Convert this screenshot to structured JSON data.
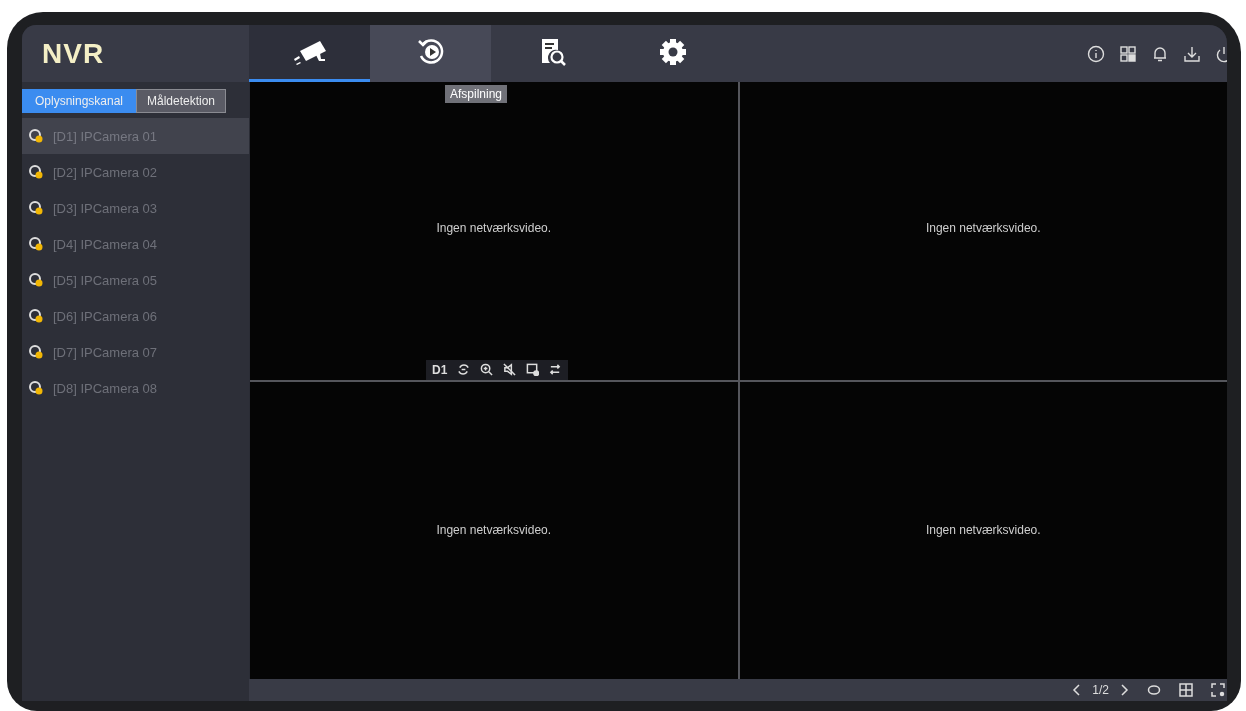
{
  "logo": "NVR",
  "nav_tabs": [
    {
      "kind": "live",
      "selected": true,
      "hovered": false
    },
    {
      "kind": "playback",
      "selected": false,
      "hovered": true,
      "tooltip": "Afspilning"
    },
    {
      "kind": "search",
      "selected": false,
      "hovered": false
    },
    {
      "kind": "settings",
      "selected": false,
      "hovered": false
    }
  ],
  "header_icons": [
    {
      "kind": "info"
    },
    {
      "kind": "qr"
    },
    {
      "kind": "bell"
    },
    {
      "kind": "download"
    },
    {
      "kind": "power"
    }
  ],
  "sidebar": {
    "tabs": [
      {
        "label": "Oplysningskanal",
        "selected": true
      },
      {
        "label": "Måldetektion",
        "selected": false
      }
    ],
    "channels": [
      {
        "label": "[D1] IPCamera 01",
        "selected": true
      },
      {
        "label": "[D2] IPCamera 02",
        "selected": false
      },
      {
        "label": "[D3] IPCamera 03",
        "selected": false
      },
      {
        "label": "[D4] IPCamera 04",
        "selected": false
      },
      {
        "label": "[D5] IPCamera 05",
        "selected": false
      },
      {
        "label": "[D6] IPCamera 06",
        "selected": false
      },
      {
        "label": "[D7] IPCamera 07",
        "selected": false
      },
      {
        "label": "[D8] IPCamera 08",
        "selected": false
      }
    ]
  },
  "tiles": [
    {
      "message": "Ingen netværksvideo.",
      "toolbar": {
        "label": "D1",
        "icons": [
          {
            "kind": "rotate"
          },
          {
            "kind": "zoom"
          },
          {
            "kind": "mute"
          },
          {
            "kind": "snapshot"
          },
          {
            "kind": "switch"
          }
        ]
      }
    },
    {
      "message": "Ingen netværksvideo."
    },
    {
      "message": "Ingen netværksvideo."
    },
    {
      "message": "Ingen netværksvideo."
    }
  ],
  "footer": {
    "page": "1/2",
    "icons": [
      {
        "kind": "cycle"
      },
      {
        "kind": "grid"
      },
      {
        "kind": "fullscreen"
      }
    ]
  }
}
